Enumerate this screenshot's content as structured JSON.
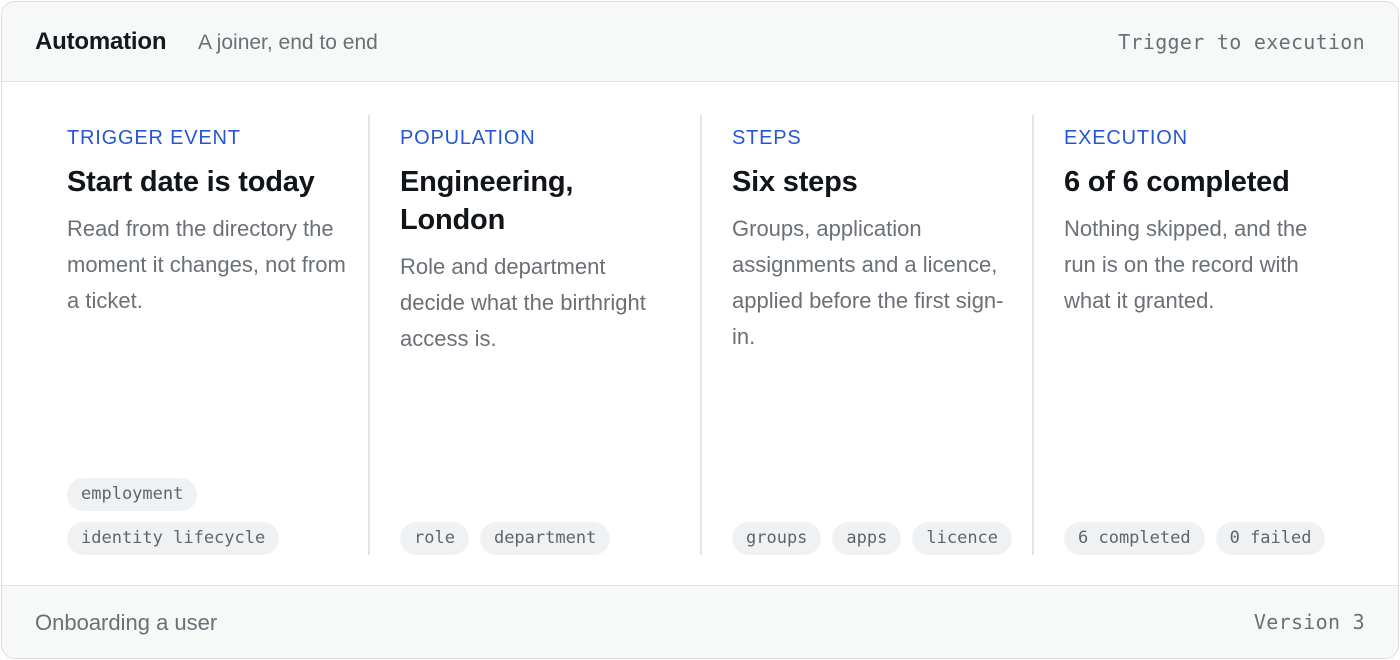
{
  "header": {
    "title": "Automation",
    "subtitle": "A joiner, end to end",
    "right_label": "Trigger to execution"
  },
  "columns": [
    {
      "eyebrow": "TRIGGER EVENT",
      "title": "Start date is today",
      "body": "Read from the directory the moment it changes, not from a ticket.",
      "tags": [
        "employment",
        "identity lifecycle"
      ]
    },
    {
      "eyebrow": "POPULATION",
      "title": "Engineering, London",
      "body": "Role and department decide what the birthright access is.",
      "tags": [
        "role",
        "department"
      ]
    },
    {
      "eyebrow": "STEPS",
      "title": "Six steps",
      "body": "Groups, application assignments and a licence, applied before the first sign-in.",
      "tags": [
        "groups",
        "apps",
        "licence"
      ]
    },
    {
      "eyebrow": "EXECUTION",
      "title": "6 of 6 completed",
      "body": "Nothing skipped, and the run is on the record with what it granted.",
      "tags": [
        "6 completed",
        "0 failed"
      ]
    }
  ],
  "footer": {
    "left_label": "Onboarding a user",
    "right_label": "Version 3"
  }
}
